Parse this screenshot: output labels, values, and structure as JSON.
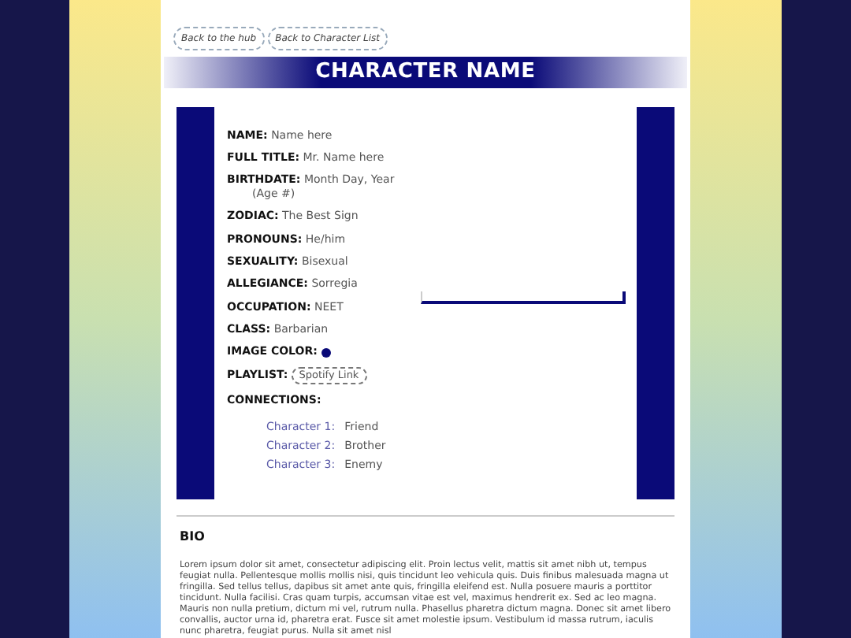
{
  "nav_buttons": [
    "Back to the hub",
    "Back to Character List"
  ],
  "title": "CHARACTER NAME",
  "fields": [
    {
      "label": "NAME:",
      "value": "Name here"
    },
    {
      "label": "FULL TITLE:",
      "value": "Mr. Name here"
    },
    {
      "label": "BIRTHDATE:",
      "value": "Month Day, Year",
      "note": "(Age #)"
    },
    {
      "label": "ZODIAC:",
      "value": "The Best Sign"
    },
    {
      "label": "PRONOUNS:",
      "value": "He/him"
    },
    {
      "label": "SEXUALITY:",
      "value": "Bisexual"
    },
    {
      "label": "ALLEGIANCE:",
      "value": "Sorregia"
    },
    {
      "label": "OCCUPATION:",
      "value": "NEET"
    },
    {
      "label": "CLASS:",
      "value": "Barbarian"
    }
  ],
  "image_color": {
    "label": "IMAGE COLOR:",
    "color": "#0a0a78"
  },
  "playlist": {
    "label": "PLAYLIST:",
    "link": "Spotify Link"
  },
  "connections": {
    "label": "CONNECTIONS:",
    "items": [
      {
        "name": "Character 1:",
        "relation": "Friend"
      },
      {
        "name": "Character 2:",
        "relation": "Brother"
      },
      {
        "name": "Character 3:",
        "relation": "Enemy"
      }
    ]
  },
  "bio": {
    "heading": "BIO",
    "text": "Lorem ipsum dolor sit amet, consectetur adipiscing elit. Proin lectus velit, mattis sit amet nibh ut, tempus feugiat nulla. Pellentesque mollis mollis nisi, quis tincidunt leo vehicula quis. Duis finibus malesuada magna ut fringilla. Sed tellus tellus, dapibus sit amet ante quis, fringilla eleifend est. Nulla posuere mauris a porttitor tincidunt. Nulla facilisi. Cras quam turpis, accumsan vitae est vel, maximus hendrerit ex. Sed ac leo magna. Mauris non nulla pretium, dictum mi vel, rutrum nulla. Phasellus pharetra dictum magna. Donec sit amet libero convallis, auctor urna id, pharetra erat. Fusce sit amet molestie ipsum. Vestibulum id massa rutrum, iaculis nunc pharetra, feugiat purus. Nulla sit amet nisl"
  }
}
